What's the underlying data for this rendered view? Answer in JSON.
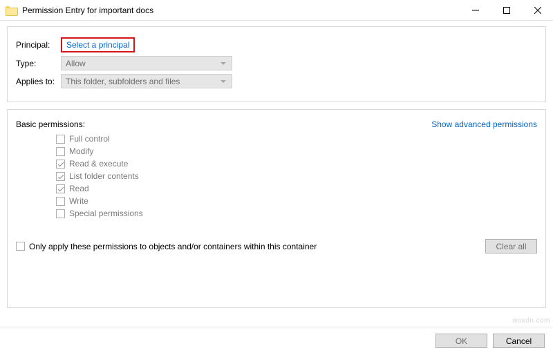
{
  "title": "Permission Entry for important docs",
  "top": {
    "principal_label": "Principal:",
    "principal_link": "Select a principal",
    "type_label": "Type:",
    "type_value": "Allow",
    "applies_label": "Applies to:",
    "applies_value": "This folder, subfolders and files"
  },
  "perm": {
    "header": "Basic permissions:",
    "show_adv": "Show advanced permissions",
    "items": [
      {
        "label": "Full control",
        "checked": false
      },
      {
        "label": "Modify",
        "checked": false
      },
      {
        "label": "Read & execute",
        "checked": true
      },
      {
        "label": "List folder contents",
        "checked": true
      },
      {
        "label": "Read",
        "checked": true
      },
      {
        "label": "Write",
        "checked": false
      },
      {
        "label": "Special permissions",
        "checked": false
      }
    ],
    "only_apply": "Only apply these permissions to objects and/or containers within this container",
    "clear_all": "Clear all"
  },
  "footer": {
    "ok": "OK",
    "cancel": "Cancel"
  },
  "watermark": "wsxdn.com"
}
